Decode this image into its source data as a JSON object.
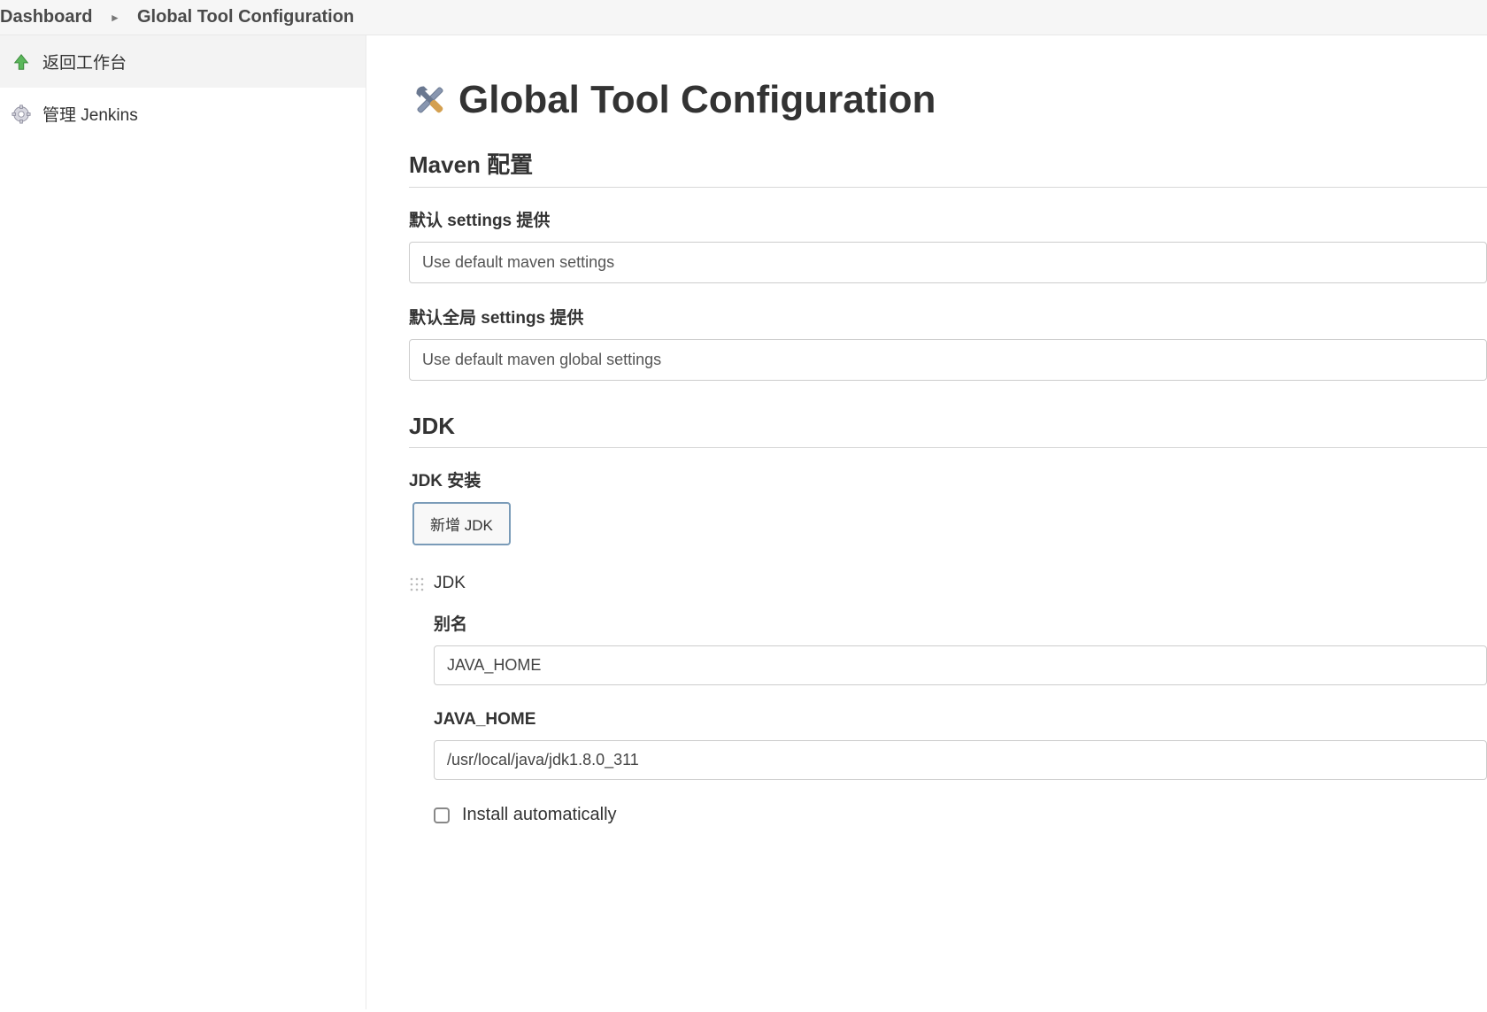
{
  "breadcrumb": {
    "items": [
      "Dashboard",
      "Global Tool Configuration"
    ]
  },
  "sidebar": {
    "items": [
      {
        "label": "返回工作台",
        "icon": "arrow-up"
      },
      {
        "label": "管理 Jenkins",
        "icon": "gear"
      }
    ]
  },
  "page": {
    "title": "Global Tool Configuration"
  },
  "maven": {
    "section_title": "Maven 配置",
    "default_settings_label": "默认 settings 提供",
    "default_settings_value": "Use default maven settings",
    "default_global_settings_label": "默认全局 settings 提供",
    "default_global_settings_value": "Use default maven global settings"
  },
  "jdk": {
    "section_title": "JDK",
    "install_label": "JDK 安装",
    "add_button_label": "新增 JDK",
    "entry_title": "JDK",
    "alias_label": "别名",
    "alias_value": "JAVA_HOME",
    "home_label": "JAVA_HOME",
    "home_value": "/usr/local/java/jdk1.8.0_311",
    "install_auto_label": "Install automatically",
    "install_auto_checked": false
  }
}
